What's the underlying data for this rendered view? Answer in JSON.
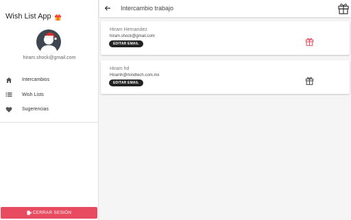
{
  "app": {
    "title": "Wish List App",
    "title_icon": "gift-icon"
  },
  "user": {
    "email": "hiram.shock@gmail.com",
    "avatar": "santa-hat-avatar"
  },
  "nav": {
    "items": [
      {
        "label": "Intercambios",
        "icon": "home-icon"
      },
      {
        "label": "Wish Lists",
        "icon": "list-icon"
      },
      {
        "label": "Sugerencias",
        "icon": "heart-icon"
      }
    ]
  },
  "logout": {
    "label": "CERRAR SESIÓN",
    "icon": "logout-icon"
  },
  "header": {
    "title": "Intercambio trabajo",
    "back_icon": "arrow-left-icon",
    "action_icon": "gift-icon"
  },
  "participants": [
    {
      "name": "Hiram Hernandez",
      "email": "hiram.shock@gmail.com",
      "button": "EDITAR EMAIL",
      "gift_color": "#e84a5f"
    },
    {
      "name": "Hiram hd",
      "email": "Hiramh@mindtech.com.mx",
      "button": "EDITAR EMAIL",
      "gift_color": "#444444"
    }
  ],
  "colors": {
    "accent": "#e84a5f",
    "button_dark": "#222222",
    "title_gift": "#f9a825"
  }
}
